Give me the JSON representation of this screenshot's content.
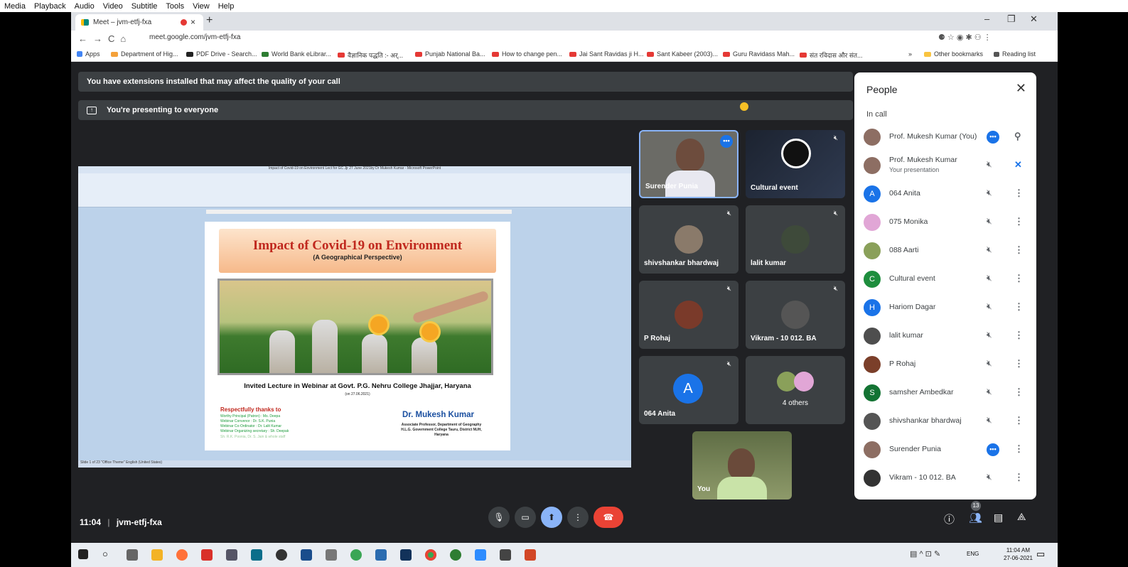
{
  "menubar": [
    "Media",
    "Playback",
    "Audio",
    "Video",
    "Subtitle",
    "Tools",
    "View",
    "Help"
  ],
  "browser": {
    "tab_title": "Meet – jvm-etfj-fxa",
    "tab_close": "×",
    "new_tab": "+",
    "url": "meet.google.com/jvm-etfj-fxa",
    "win_min": "–",
    "win_max": "❐",
    "win_close": "✕"
  },
  "bookmarks": [
    "Apps",
    "Department of Hig...",
    "PDF Drive - Search...",
    "World Bank eLibrar...",
    "वैज्ञानिक पद्धति :- अर्...",
    "Punjab National Ba...",
    "How to change pen...",
    "Jai Sant Ravidas ji H...",
    "Sant Kabeer (2003)...",
    "Guru Ravidass Mah...",
    "संत रविदास और संत...",
    "»",
    "Other bookmarks",
    "Reading list"
  ],
  "banners": {
    "extensions": "You have extensions installed that may affect the quality of your call",
    "presenting": "You're presenting to everyone"
  },
  "slide": {
    "window_title": "Impact of Covid-19 on Environment Lect for GC Jjr 27 June 2021by Dr Mukesh Kumar - Microsoft PowerPoint",
    "title": "Impact of Covid-19 on Environment",
    "subtitle": "(A Geographical Perspective)",
    "invited": "Invited Lecture in Webinar at Govt. P.G. Nehru College Jhajjar, Haryana",
    "date": "(on 27.06.2021)",
    "thanks": "Respectfully thanks to",
    "credits": [
      "Worthy Principal (Patron)      : Ms. Deepa",
      "Webinar Convenor                 : Dr. S.K. Punia",
      "Webinar Co-Ordinator            : Dr. Lalit Kumar",
      "Webinar Organizing secretary : Sh. Deepak",
      "Sh. R.K. Poonia, Dr. S. Jain & whole staff"
    ],
    "author": "Dr. Mukesh Kumar",
    "affiliation": [
      "Associate Professor, Department of Geography",
      "H.L.G. Government College Tauru, District NUH,",
      "Haryana"
    ],
    "status": "Slide 1 of 23   \"Office Theme\"   English (United States)"
  },
  "tiles": [
    {
      "name": "Surender Punia"
    },
    {
      "name": "Cultural event"
    },
    {
      "name": "shivshankar bhardwaj"
    },
    {
      "name": "lalit kumar"
    },
    {
      "name": "P Rohaj"
    },
    {
      "name": "Vikram - 10 012. BA"
    },
    {
      "name": "064 Anita",
      "initial": "A"
    },
    {
      "name": "4 others"
    },
    {
      "name": "You"
    }
  ],
  "people": {
    "title": "People",
    "close": "✕",
    "section": "In call",
    "list": [
      {
        "name": "Prof. Mukesh Kumar (You)",
        "color": "#8d6e63"
      },
      {
        "name": "Prof. Mukesh Kumar",
        "sub": "Your presentation",
        "color": "#8d6e63"
      },
      {
        "name": "064 Anita",
        "initial": "A",
        "color": "#1a73e8"
      },
      {
        "name": "075 Monika",
        "color": "#e1a6d6"
      },
      {
        "name": "088 Aarti",
        "color": "#8aa05a"
      },
      {
        "name": "Cultural event",
        "initial": "C",
        "color": "#1e8e3e"
      },
      {
        "name": "Hariom Dagar",
        "initial": "H",
        "color": "#1a73e8"
      },
      {
        "name": "lalit kumar",
        "color": "#4e4e4e"
      },
      {
        "name": "P Rohaj",
        "color": "#7b3f2a"
      },
      {
        "name": "samsher Ambedkar",
        "initial": "S",
        "color": "#137333"
      },
      {
        "name": "shivshankar bhardwaj",
        "color": "#555"
      },
      {
        "name": "Surender Punia",
        "color": "#8d6e63"
      },
      {
        "name": "Vikram - 10 012. BA",
        "color": "#333"
      }
    ]
  },
  "bottom": {
    "time": "11:04",
    "separator": "|",
    "code": "jvm-etfj-fxa",
    "people_count": "13"
  },
  "taskbar": {
    "lang": "ENG",
    "time": "11:04 AM",
    "date": "27-06-2021"
  }
}
